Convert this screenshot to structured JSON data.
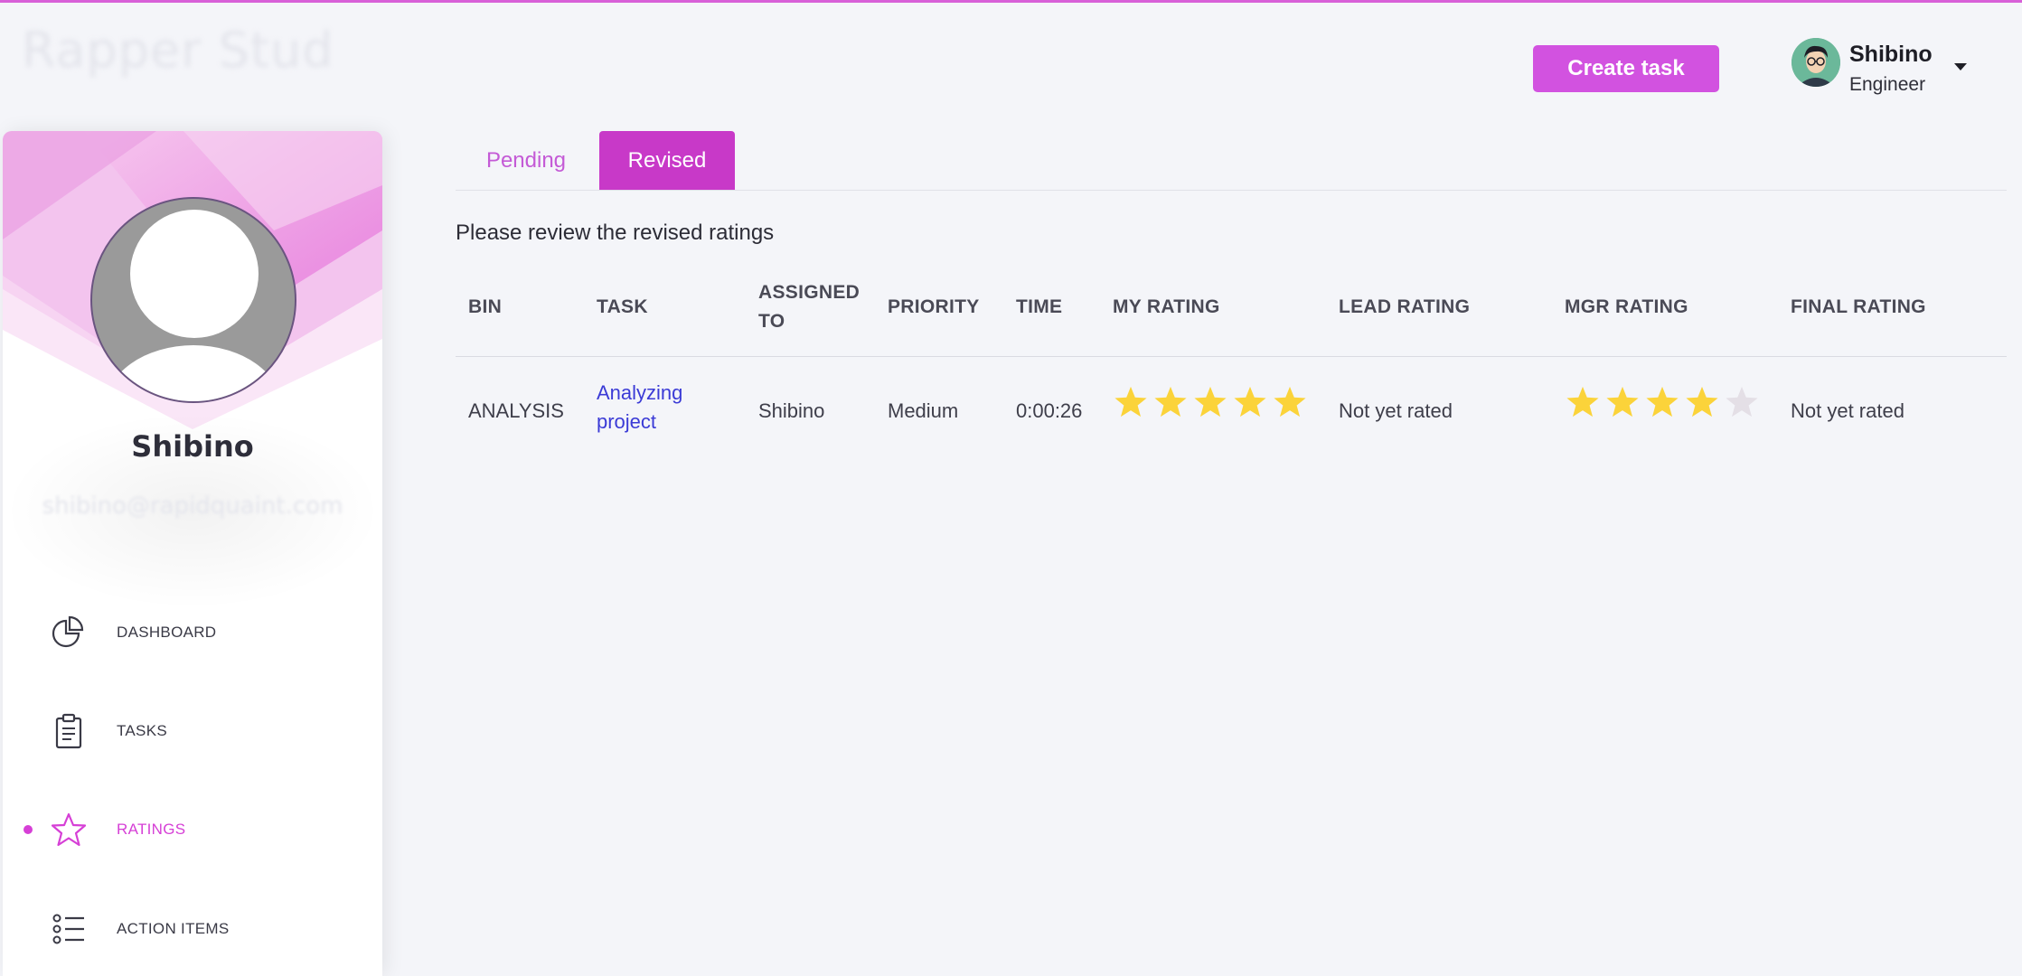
{
  "logo": {
    "text": "Rapper Study"
  },
  "header": {
    "create_task_label": "Create task",
    "user": {
      "name": "Shibino",
      "role": "Engineer"
    }
  },
  "sidebar": {
    "profile": {
      "name": "Shibino",
      "email": "shibino@rapidquaint.com"
    },
    "items": [
      {
        "label": "DASHBOARD",
        "icon": "pie-chart-icon",
        "active": false
      },
      {
        "label": "TASKS",
        "icon": "clipboard-icon",
        "active": false
      },
      {
        "label": "RATINGS",
        "icon": "star-outline-icon",
        "active": true
      },
      {
        "label": "ACTION ITEMS",
        "icon": "list-icon",
        "active": false
      }
    ]
  },
  "tabs": [
    {
      "label": "Pending",
      "active": false
    },
    {
      "label": "Revised",
      "active": true
    }
  ],
  "review_message": "Please review the revised ratings",
  "table": {
    "headers": [
      "BIN",
      "TASK",
      "ASSIGNED TO",
      "PRIORITY",
      "TIME",
      "MY RATING",
      "LEAD RATING",
      "MGR RATING",
      "FINAL RATING"
    ],
    "rows": [
      {
        "bin": "ANALYSIS",
        "task": "Analyzing project",
        "assigned_to": "Shibino",
        "priority": "Medium",
        "time": "0:00:26",
        "my_rating": 5,
        "lead_rating": "Not yet rated",
        "mgr_rating": 4,
        "final_rating": "Not yet rated",
        "max_rating": 5
      }
    ]
  },
  "colors": {
    "accent": "#d252e0",
    "active_tab": "#c839c8",
    "star_filled": "#fbd33a",
    "star_empty": "#e4dfe6",
    "link": "#3b3bd6",
    "background": "#f4f5f9"
  }
}
